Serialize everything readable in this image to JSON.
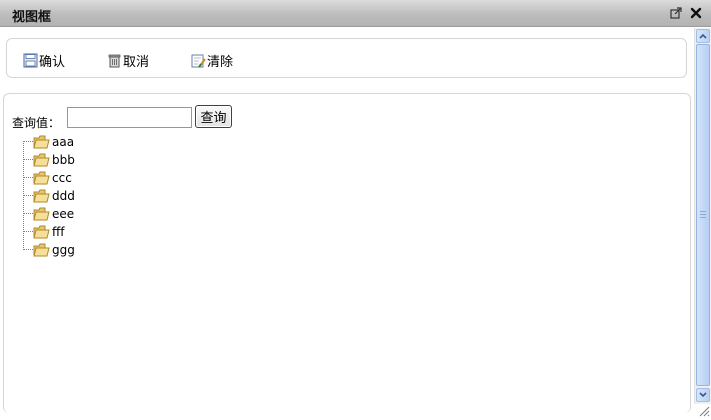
{
  "window": {
    "title": "视图框"
  },
  "titlebar": {
    "popout_icon": "popout-icon",
    "close_icon": "close-icon"
  },
  "toolbar": {
    "confirm_label": "确认",
    "cancel_label": "取消",
    "clear_label": "清除",
    "confirm_icon": "save-icon",
    "cancel_icon": "trash-icon",
    "clear_icon": "clear-icon"
  },
  "search": {
    "label": "查询值：",
    "value": "",
    "placeholder": "",
    "button_label": "查询"
  },
  "tree": {
    "items": [
      {
        "label": "aaa"
      },
      {
        "label": "bbb"
      },
      {
        "label": "ccc"
      },
      {
        "label": "ddd"
      },
      {
        "label": "eee"
      },
      {
        "label": "fff"
      },
      {
        "label": "ggg"
      }
    ],
    "item_icon": "folder-icon"
  },
  "colors": {
    "scroll_accent": "#b6cff3",
    "titlebar": "#c4c4c4"
  }
}
